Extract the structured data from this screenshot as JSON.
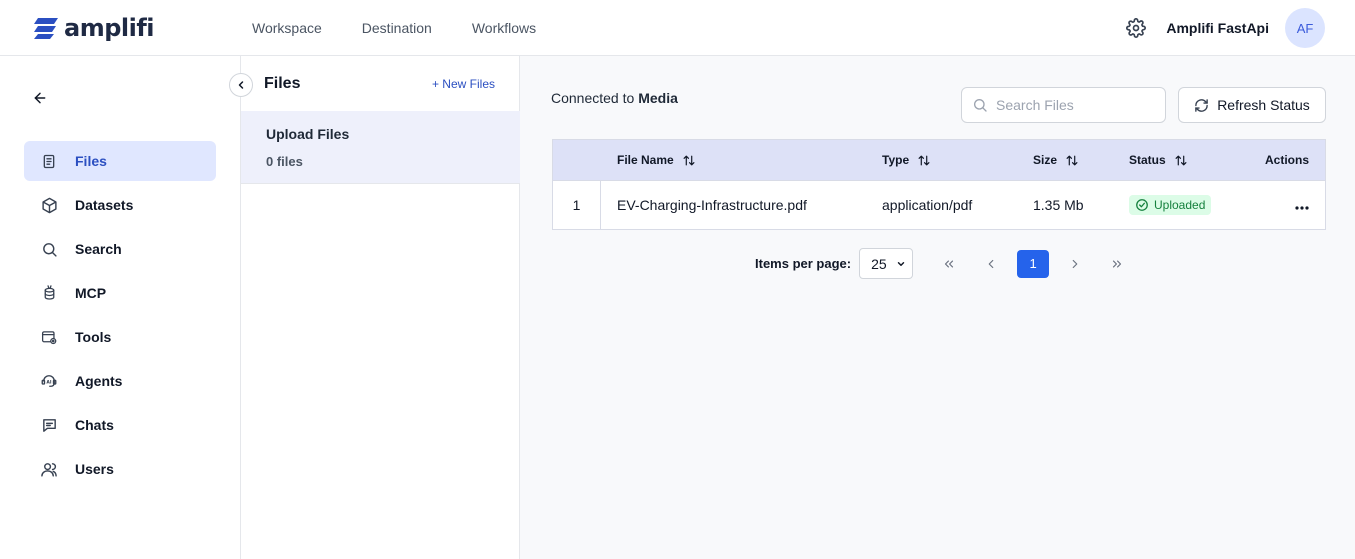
{
  "brand": {
    "name": "amplifi",
    "color": "#2b4fc1"
  },
  "topnav": {
    "items": [
      "Workspace",
      "Destination",
      "Workflows"
    ]
  },
  "user": {
    "name": "Amplifi FastApi",
    "initials": "AF"
  },
  "sidebar": {
    "items": [
      {
        "label": "Files",
        "icon": "file-icon",
        "active": true
      },
      {
        "label": "Datasets",
        "icon": "cube-icon"
      },
      {
        "label": "Search",
        "icon": "search-icon"
      },
      {
        "label": "MCP",
        "icon": "mcp-icon"
      },
      {
        "label": "Tools",
        "icon": "tools-icon"
      },
      {
        "label": "Agents",
        "icon": "agents-icon"
      },
      {
        "label": "Chats",
        "icon": "chat-icon"
      },
      {
        "label": "Users",
        "icon": "users-icon"
      }
    ]
  },
  "files_panel": {
    "title": "Files",
    "new_label": "+ New Files",
    "item": {
      "title": "Upload Files",
      "count": "0 files"
    }
  },
  "main": {
    "connected_prefix": "Connected to",
    "connected_target": "Media",
    "search_placeholder": "Search Files",
    "refresh_label": "Refresh Status",
    "table": {
      "columns": [
        "File Name",
        "Type",
        "Size",
        "Status",
        "Actions"
      ],
      "rows": [
        {
          "index": "1",
          "name": "EV-Charging-Infrastructure.pdf",
          "type": "application/pdf",
          "size": "1.35 Mb",
          "status": "Uploaded"
        }
      ]
    },
    "pagination": {
      "label": "Items per page:",
      "per_page": "25",
      "current_page": "1"
    }
  }
}
